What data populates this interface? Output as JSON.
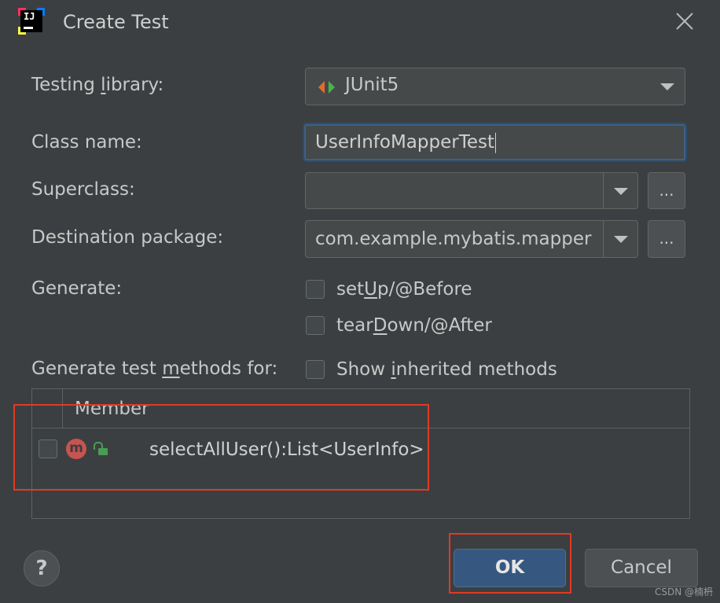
{
  "window": {
    "title": "Create Test",
    "app_icon_text": "IJ"
  },
  "form": {
    "testing_library": {
      "label_pre": "Testing ",
      "label_u": "l",
      "label_post": "ibrary:",
      "value": "JUnit5"
    },
    "class_name": {
      "label": "Class name:",
      "value": "UserInfoMapperTest"
    },
    "superclass": {
      "label": "Superclass:",
      "value": "",
      "browse": "..."
    },
    "destination_package": {
      "label": "Destination package:",
      "value": "com.example.mybatis.mapper",
      "browse": "..."
    },
    "generate": {
      "label": "Generate:",
      "setup": {
        "pre": "set",
        "u": "U",
        "post": "p/@Before",
        "checked": false
      },
      "teardown": {
        "pre": "tear",
        "u": "D",
        "post": "own/@After",
        "checked": false
      }
    },
    "methods_for": {
      "label_pre": "Generate test ",
      "label_u": "m",
      "label_post": "ethods for:"
    },
    "show_inherited": {
      "pre": "Show ",
      "u": "i",
      "post": "nherited methods",
      "checked": false
    }
  },
  "members_table": {
    "column": "Member",
    "rows": [
      {
        "badge": "m",
        "signature": "selectAllUser():List<UserInfo>",
        "checked": false
      }
    ]
  },
  "buttons": {
    "help": "?",
    "ok": "OK",
    "cancel": "Cancel"
  },
  "watermark": "CSDN @楠枬",
  "colors": {
    "highlight_box": "#e03a24",
    "ok_button": "#365880"
  },
  "icons": [
    "intellij-icon",
    "close-icon",
    "junit-icon",
    "chevron-down-icon",
    "method-icon",
    "unlocked-icon",
    "help-icon"
  ]
}
